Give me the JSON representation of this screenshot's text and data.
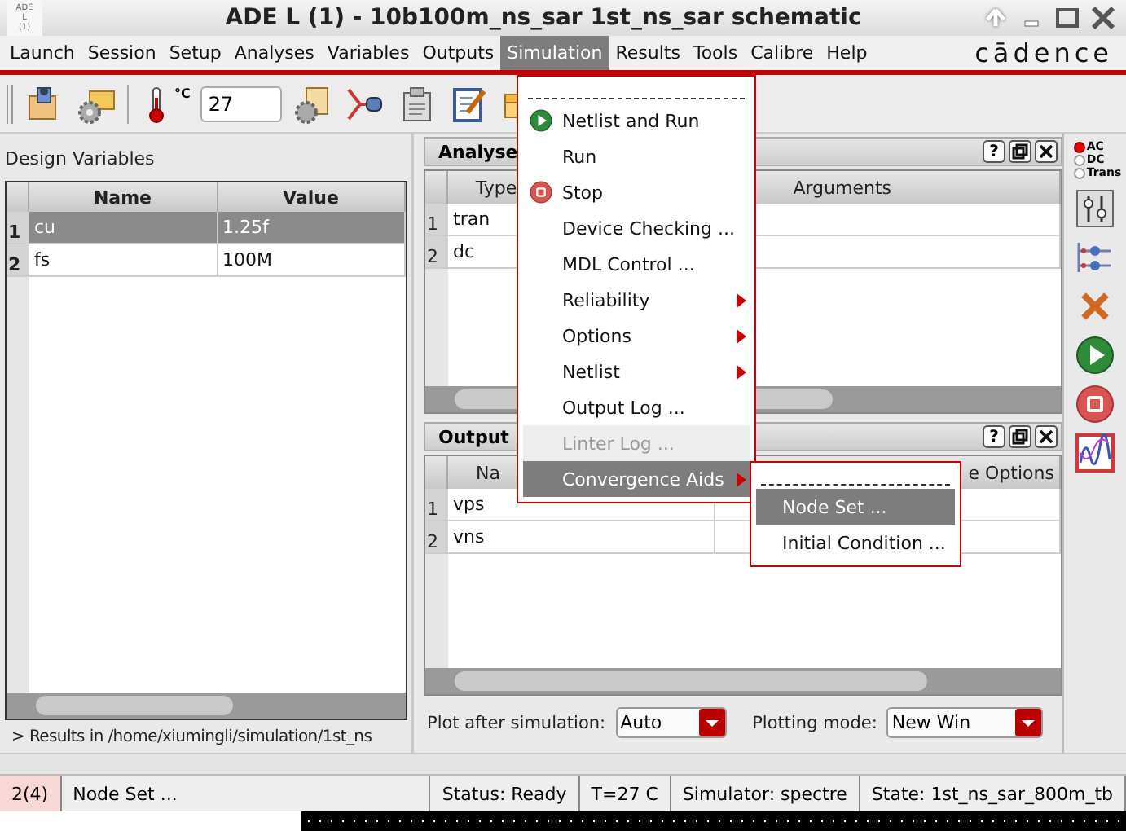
{
  "window": {
    "logo_lines": [
      "ADE",
      "L",
      "(1)"
    ],
    "title": "ADE L (1) - 10b100m_ns_sar 1st_ns_sar schematic"
  },
  "menu_bar": {
    "items": [
      {
        "label": "Launch",
        "selected": false
      },
      {
        "label": "Session",
        "selected": false
      },
      {
        "label": "Setup",
        "selected": false
      },
      {
        "label": "Analyses",
        "selected": false
      },
      {
        "label": "Variables",
        "selected": false
      },
      {
        "label": "Outputs",
        "selected": false
      },
      {
        "label": "Simulation",
        "selected": true
      },
      {
        "label": "Results",
        "selected": false
      },
      {
        "label": "Tools",
        "selected": false
      },
      {
        "label": "Calibre",
        "selected": false
      },
      {
        "label": "Help",
        "selected": false
      }
    ],
    "brand": "cādence"
  },
  "toolbar": {
    "temp_unit": "°C",
    "temperature": "27"
  },
  "design_variables": {
    "title": "Design Variables",
    "columns": [
      "Name",
      "Value"
    ],
    "rows": [
      {
        "index": "1",
        "name": "cu",
        "value": "1.25f",
        "selected": true
      },
      {
        "index": "2",
        "name": "fs",
        "value": "100M",
        "selected": false
      }
    ],
    "results": "> Results in /home/xiumingli/simulation/1st_ns"
  },
  "analyses": {
    "title": "Analyse",
    "help": "?",
    "columns": [
      "Type",
      "Arguments"
    ],
    "rows": [
      {
        "index": "1",
        "type": "tran"
      },
      {
        "index": "2",
        "type": "dc"
      }
    ]
  },
  "outputs": {
    "title": "Output",
    "help": "?",
    "columns": [
      "Na",
      "e Options"
    ],
    "rows": [
      {
        "index": "1",
        "name": "vps"
      },
      {
        "index": "2",
        "name": "vns"
      }
    ]
  },
  "plot_options": {
    "plot_after_label": "Plot after simulation:",
    "plot_after": "Auto",
    "mode_label": "Plotting mode:",
    "mode": "New Win"
  },
  "analysis_type": [
    {
      "label": "AC",
      "selected": true
    },
    {
      "label": "DC",
      "selected": false
    },
    {
      "label": "Trans",
      "selected": false
    }
  ],
  "status_bar": {
    "count": "2(4)",
    "message": "Node Set ...",
    "status": "Status: Ready",
    "temperature": "T=27 C",
    "simulator": "Simulator: spectre",
    "state": "State: 1st_ns_sar_800m_tb"
  },
  "simulation_menu": {
    "items": [
      {
        "kind": "tearoff"
      },
      {
        "kind": "play",
        "label": "Netlist and Run",
        "submenu": false,
        "disabled": false,
        "selected": false
      },
      {
        "kind": "item",
        "label": "Run",
        "submenu": false,
        "disabled": false,
        "selected": false
      },
      {
        "kind": "stop",
        "label": "Stop",
        "submenu": false,
        "disabled": false,
        "selected": false
      },
      {
        "kind": "item",
        "label": "Device Checking ...",
        "submenu": false,
        "disabled": false,
        "selected": false
      },
      {
        "kind": "item",
        "label": "MDL Control ...",
        "submenu": false,
        "disabled": false,
        "selected": false
      },
      {
        "kind": "item",
        "label": "Reliability",
        "submenu": true,
        "disabled": false,
        "selected": false
      },
      {
        "kind": "item",
        "label": "Options",
        "submenu": true,
        "disabled": false,
        "selected": false
      },
      {
        "kind": "item",
        "label": "Netlist",
        "submenu": true,
        "disabled": false,
        "selected": false
      },
      {
        "kind": "item",
        "label": "Output Log ...",
        "submenu": false,
        "disabled": false,
        "selected": false
      },
      {
        "kind": "item",
        "label": "Linter Log ...",
        "submenu": false,
        "disabled": true,
        "selected": false
      },
      {
        "kind": "item",
        "label": "Convergence Aids",
        "submenu": true,
        "disabled": false,
        "selected": true
      }
    ]
  },
  "convergence_menu": {
    "items": [
      {
        "kind": "tearoff"
      },
      {
        "kind": "item",
        "label": "Node Set ...",
        "submenu": false,
        "disabled": false,
        "selected": true
      },
      {
        "kind": "item",
        "label": "Initial Condition ...",
        "submenu": false,
        "disabled": false,
        "selected": false
      }
    ]
  }
}
